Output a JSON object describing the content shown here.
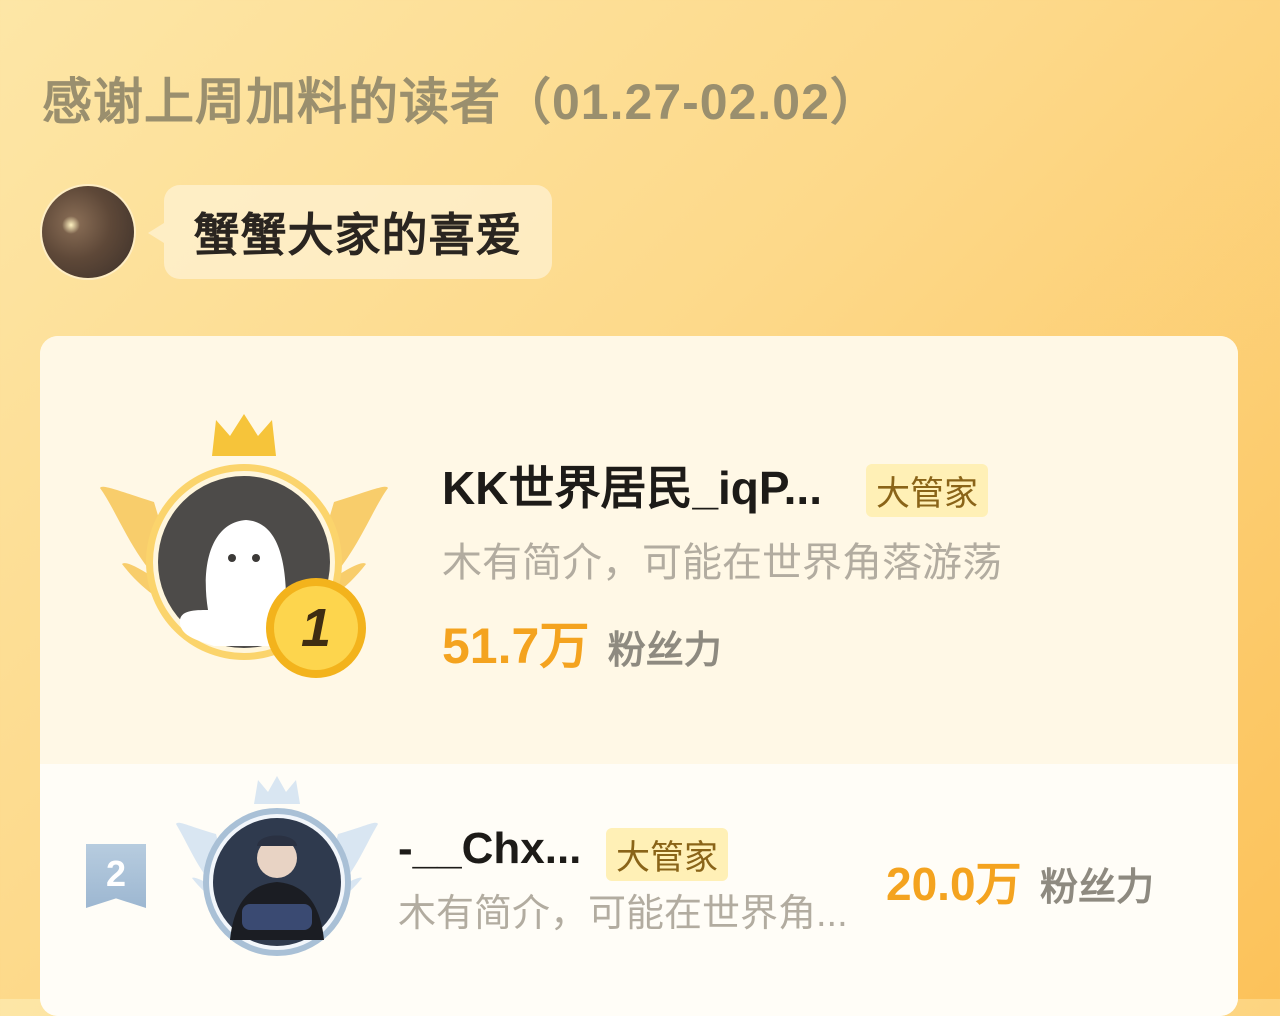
{
  "header": {
    "title": "感谢上周加料的读者（01.27-02.02）"
  },
  "message": {
    "text": "蟹蟹大家的喜爱"
  },
  "leaderboard": {
    "entries": [
      {
        "rank": "1",
        "name": "KK世界居民_iqP...",
        "tag": "大管家",
        "bio": "木有简介，可能在世界角落游荡",
        "fans_value": "51.7万",
        "fans_label": "粉丝力"
      },
      {
        "rank": "2",
        "name": "-__Chx...",
        "tag": "大管家",
        "bio": "木有简介，可能在世界角...",
        "fans_value": "20.0万",
        "fans_label": "粉丝力"
      }
    ]
  },
  "colors": {
    "accent": "#f4a31f",
    "title": "#9a8f6e",
    "tag_bg": "#fff0b6",
    "rank2": "#9db7d1"
  }
}
